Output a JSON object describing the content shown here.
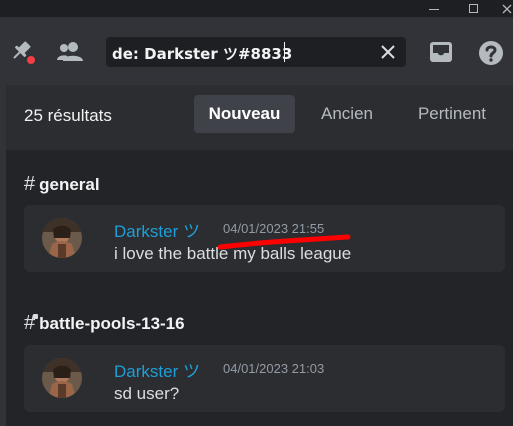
{
  "window": {
    "controls": [
      "minimize-icon",
      "maximize-icon",
      "close-icon"
    ]
  },
  "toolbar": {
    "icons": [
      "pin-icon",
      "members-icon",
      "inbox-icon",
      "help-icon"
    ],
    "notification_color": "#f23f43",
    "search": {
      "value": "de: Darkster ツ#8833"
    }
  },
  "results": {
    "count_label": "25 résultats",
    "sort_tabs": [
      {
        "label": "Nouveau",
        "active": true
      },
      {
        "label": "Ancien",
        "active": false
      },
      {
        "label": "Pertinent",
        "active": false
      }
    ]
  },
  "groups": [
    {
      "channel": "general",
      "channel_icon": "hash-icon",
      "message": {
        "author": "Darkster ツ",
        "timestamp": "04/01/2023 21:55",
        "content": "i love the battle my balls league"
      }
    },
    {
      "channel": "battle-pools-13-16",
      "channel_icon": "thread-hash-icon",
      "message": {
        "author": "Darkster ツ",
        "timestamp": "04/01/2023 21:03",
        "content": "sd user?"
      }
    }
  ],
  "colors": {
    "author": "#1e9fd8",
    "annotation": "#ff0000",
    "accent_bg": "#404249"
  }
}
